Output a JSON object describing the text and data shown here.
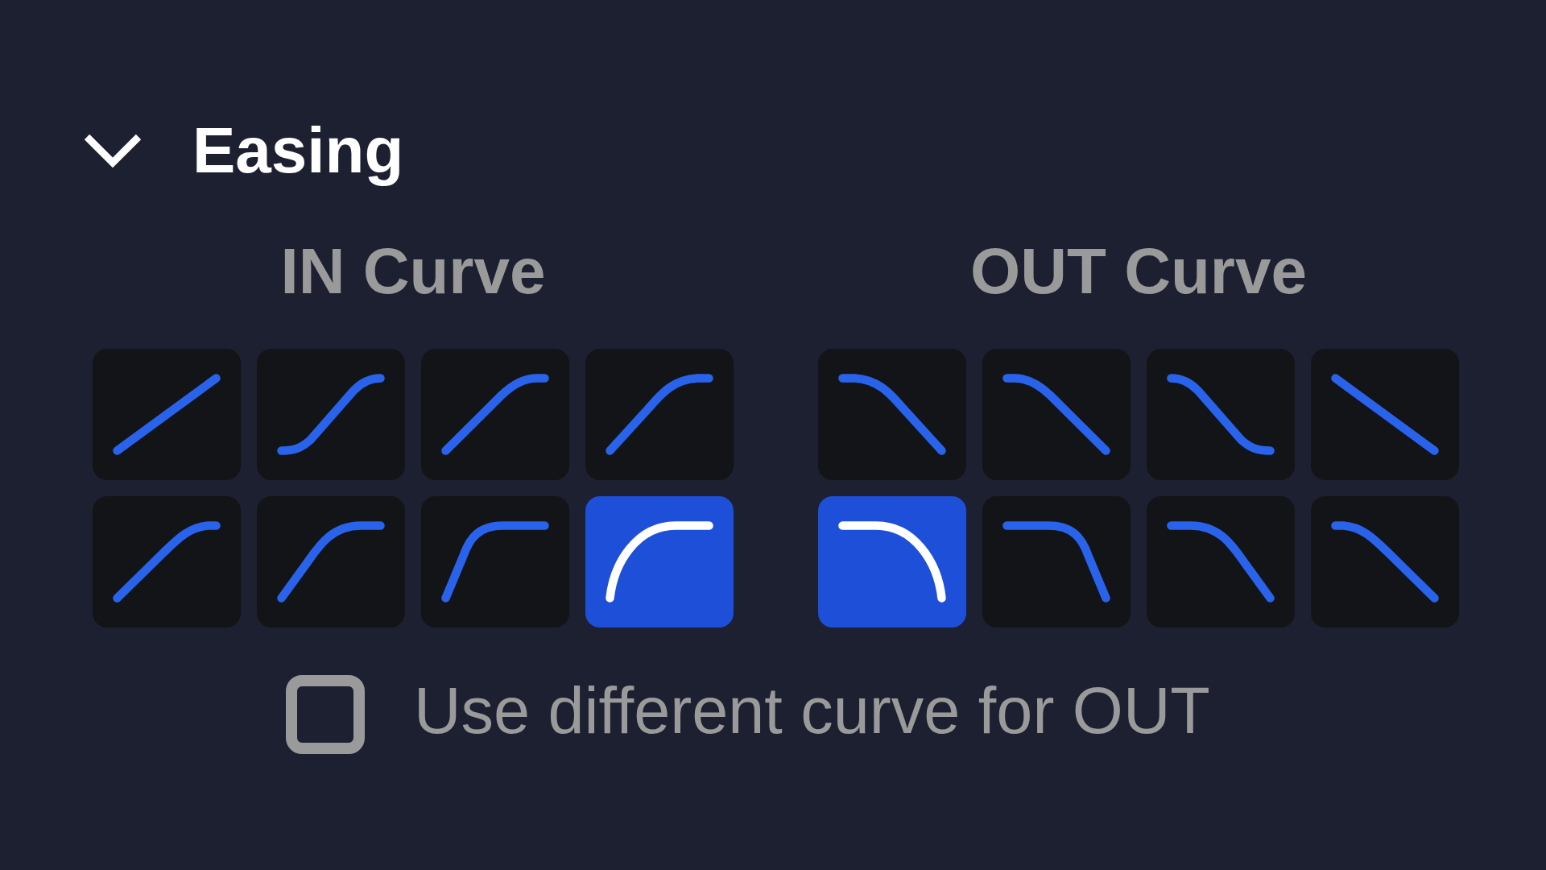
{
  "section": {
    "title": "Easing",
    "expanded": true
  },
  "in_curve": {
    "title": "IN Curve",
    "presets": [
      {
        "kind": "linear",
        "selected": false
      },
      {
        "kind": "sine",
        "selected": false
      },
      {
        "kind": "quad",
        "selected": false
      },
      {
        "kind": "cubic",
        "selected": false
      },
      {
        "kind": "quart",
        "selected": false
      },
      {
        "kind": "quint",
        "selected": false
      },
      {
        "kind": "expo",
        "selected": false
      },
      {
        "kind": "circ",
        "selected": true
      }
    ]
  },
  "out_curve": {
    "title": "OUT Curve",
    "presets": [
      {
        "kind": "cubic",
        "selected": false
      },
      {
        "kind": "quad",
        "selected": false
      },
      {
        "kind": "sine",
        "selected": false
      },
      {
        "kind": "linear",
        "selected": false
      },
      {
        "kind": "circ",
        "selected": true
      },
      {
        "kind": "expo",
        "selected": false
      },
      {
        "kind": "quint",
        "selected": false
      },
      {
        "kind": "quart",
        "selected": false
      }
    ]
  },
  "option": {
    "label": "Use different curve for OUT",
    "checked": false
  }
}
